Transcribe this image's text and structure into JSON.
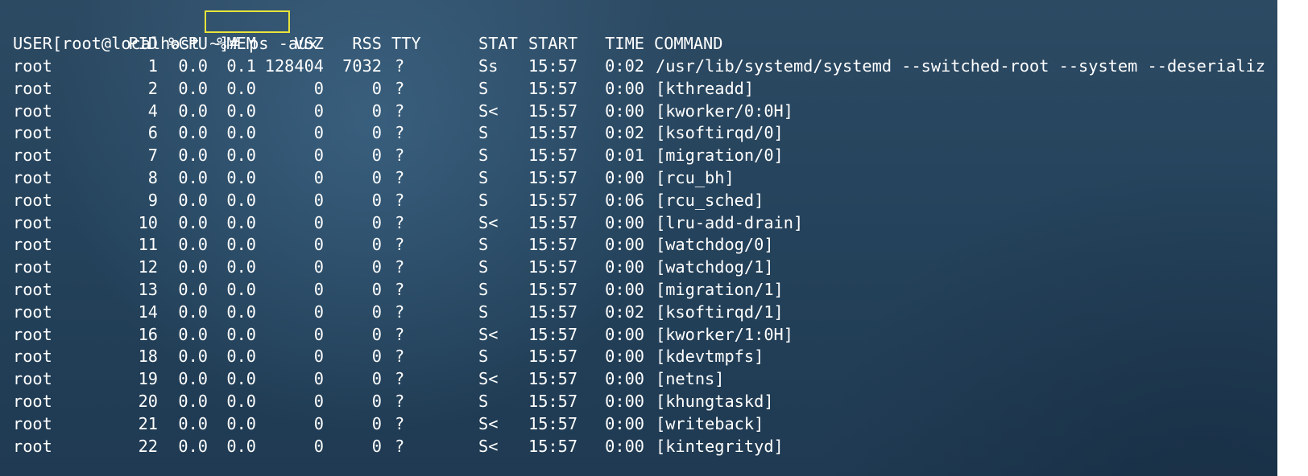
{
  "prompt": {
    "text": "[root@localhost ~]# ",
    "command": "ps -aux"
  },
  "headers": {
    "user": "USER",
    "pid": "PID",
    "cpu": "%CPU",
    "mem": "%MEM",
    "vsz": "VSZ",
    "rss": "RSS",
    "tty": "TTY",
    "stat": "STAT",
    "start": "START",
    "time": "TIME",
    "command": "COMMAND"
  },
  "rows": [
    {
      "user": "root",
      "pid": "1",
      "cpu": "0.0",
      "mem": "0.1",
      "vsz": "128404",
      "rss": "7032",
      "tty": "?",
      "stat": "Ss",
      "start": "15:57",
      "time": "0:02",
      "command": "/usr/lib/systemd/systemd --switched-root --system --deserializ"
    },
    {
      "user": "root",
      "pid": "2",
      "cpu": "0.0",
      "mem": "0.0",
      "vsz": "0",
      "rss": "0",
      "tty": "?",
      "stat": "S",
      "start": "15:57",
      "time": "0:00",
      "command": "[kthreadd]"
    },
    {
      "user": "root",
      "pid": "4",
      "cpu": "0.0",
      "mem": "0.0",
      "vsz": "0",
      "rss": "0",
      "tty": "?",
      "stat": "S<",
      "start": "15:57",
      "time": "0:00",
      "command": "[kworker/0:0H]"
    },
    {
      "user": "root",
      "pid": "6",
      "cpu": "0.0",
      "mem": "0.0",
      "vsz": "0",
      "rss": "0",
      "tty": "?",
      "stat": "S",
      "start": "15:57",
      "time": "0:02",
      "command": "[ksoftirqd/0]"
    },
    {
      "user": "root",
      "pid": "7",
      "cpu": "0.0",
      "mem": "0.0",
      "vsz": "0",
      "rss": "0",
      "tty": "?",
      "stat": "S",
      "start": "15:57",
      "time": "0:01",
      "command": "[migration/0]"
    },
    {
      "user": "root",
      "pid": "8",
      "cpu": "0.0",
      "mem": "0.0",
      "vsz": "0",
      "rss": "0",
      "tty": "?",
      "stat": "S",
      "start": "15:57",
      "time": "0:00",
      "command": "[rcu_bh]"
    },
    {
      "user": "root",
      "pid": "9",
      "cpu": "0.0",
      "mem": "0.0",
      "vsz": "0",
      "rss": "0",
      "tty": "?",
      "stat": "S",
      "start": "15:57",
      "time": "0:06",
      "command": "[rcu_sched]"
    },
    {
      "user": "root",
      "pid": "10",
      "cpu": "0.0",
      "mem": "0.0",
      "vsz": "0",
      "rss": "0",
      "tty": "?",
      "stat": "S<",
      "start": "15:57",
      "time": "0:00",
      "command": "[lru-add-drain]"
    },
    {
      "user": "root",
      "pid": "11",
      "cpu": "0.0",
      "mem": "0.0",
      "vsz": "0",
      "rss": "0",
      "tty": "?",
      "stat": "S",
      "start": "15:57",
      "time": "0:00",
      "command": "[watchdog/0]"
    },
    {
      "user": "root",
      "pid": "12",
      "cpu": "0.0",
      "mem": "0.0",
      "vsz": "0",
      "rss": "0",
      "tty": "?",
      "stat": "S",
      "start": "15:57",
      "time": "0:00",
      "command": "[watchdog/1]"
    },
    {
      "user": "root",
      "pid": "13",
      "cpu": "0.0",
      "mem": "0.0",
      "vsz": "0",
      "rss": "0",
      "tty": "?",
      "stat": "S",
      "start": "15:57",
      "time": "0:00",
      "command": "[migration/1]"
    },
    {
      "user": "root",
      "pid": "14",
      "cpu": "0.0",
      "mem": "0.0",
      "vsz": "0",
      "rss": "0",
      "tty": "?",
      "stat": "S",
      "start": "15:57",
      "time": "0:02",
      "command": "[ksoftirqd/1]"
    },
    {
      "user": "root",
      "pid": "16",
      "cpu": "0.0",
      "mem": "0.0",
      "vsz": "0",
      "rss": "0",
      "tty": "?",
      "stat": "S<",
      "start": "15:57",
      "time": "0:00",
      "command": "[kworker/1:0H]"
    },
    {
      "user": "root",
      "pid": "18",
      "cpu": "0.0",
      "mem": "0.0",
      "vsz": "0",
      "rss": "0",
      "tty": "?",
      "stat": "S",
      "start": "15:57",
      "time": "0:00",
      "command": "[kdevtmpfs]"
    },
    {
      "user": "root",
      "pid": "19",
      "cpu": "0.0",
      "mem": "0.0",
      "vsz": "0",
      "rss": "0",
      "tty": "?",
      "stat": "S<",
      "start": "15:57",
      "time": "0:00",
      "command": "[netns]"
    },
    {
      "user": "root",
      "pid": "20",
      "cpu": "0.0",
      "mem": "0.0",
      "vsz": "0",
      "rss": "0",
      "tty": "?",
      "stat": "S",
      "start": "15:57",
      "time": "0:00",
      "command": "[khungtaskd]"
    },
    {
      "user": "root",
      "pid": "21",
      "cpu": "0.0",
      "mem": "0.0",
      "vsz": "0",
      "rss": "0",
      "tty": "?",
      "stat": "S<",
      "start": "15:57",
      "time": "0:00",
      "command": "[writeback]"
    },
    {
      "user": "root",
      "pid": "22",
      "cpu": "0.0",
      "mem": "0.0",
      "vsz": "0",
      "rss": "0",
      "tty": "?",
      "stat": "S<",
      "start": "15:57",
      "time": "0:00",
      "command": "[kintegrityd]"
    }
  ],
  "colors": {
    "highlight_box": "#e8e43a",
    "text": "#ffffff"
  }
}
